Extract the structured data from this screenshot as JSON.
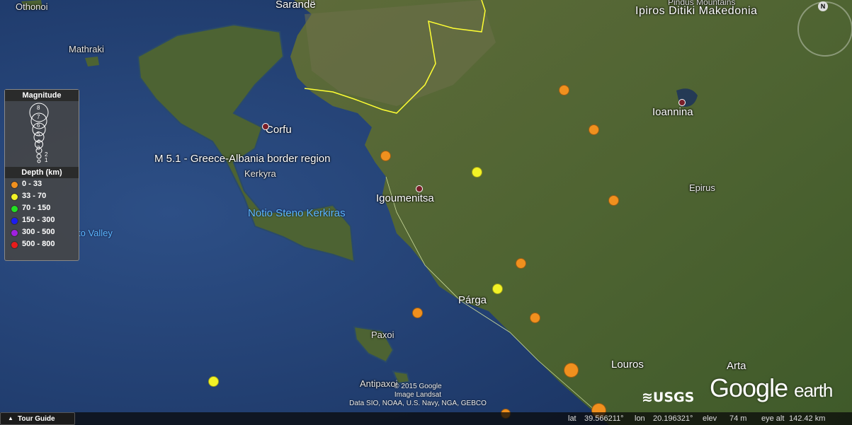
{
  "map": {
    "place_labels": {
      "othonoi": "Othonoi",
      "sarande": "Sarandë",
      "ipiros": "Ipiros Ditiki Makedonia",
      "pindus": "Pindus Mountains",
      "mathraki": "Mathraki",
      "corfu": "Corfu",
      "kerkyra": "Kerkyra",
      "ioannina": "Ioannina",
      "igoumenitsa": "Igoumenitsa",
      "epirus": "Epirus",
      "notio": "Notio Steno Kerkiras",
      "valley": "to Valley",
      "parga": "Párga",
      "paxoi": "Paxoi",
      "antipaxoi": "Antipaxoi",
      "louros": "Louros",
      "arta": "Arta"
    },
    "quake_label": "M 5.1 - Greece-Albania border region",
    "quakes": [
      {
        "depth_class": "0-33",
        "color": "#f0901e"
      },
      {
        "depth_class": "0-33",
        "color": "#f0901e"
      },
      {
        "depth_class": "0-33",
        "color": "#f0901e"
      },
      {
        "depth_class": "0-33",
        "color": "#f0901e"
      },
      {
        "depth_class": "0-33",
        "color": "#f0901e"
      },
      {
        "depth_class": "0-33",
        "color": "#f0901e"
      },
      {
        "depth_class": "0-33",
        "color": "#f0901e"
      },
      {
        "depth_class": "0-33",
        "color": "#f0901e"
      },
      {
        "depth_class": "0-33",
        "color": "#f0901e"
      },
      {
        "depth_class": "0-33",
        "color": "#f0901e"
      },
      {
        "depth_class": "33-70",
        "color": "#f2f226"
      },
      {
        "depth_class": "33-70",
        "color": "#f2f226"
      },
      {
        "depth_class": "33-70",
        "color": "#f2f226"
      }
    ]
  },
  "legend": {
    "magnitude_title": "Magnitude",
    "magnitude_values": [
      "8",
      "7",
      "6",
      "5",
      "4",
      "3",
      "2",
      "1"
    ],
    "depth_title": "Depth (km)",
    "depth_classes": [
      {
        "label": "0 - 33",
        "color": "#f0901e"
      },
      {
        "label": "33 - 70",
        "color": "#f2f226"
      },
      {
        "label": "70 - 150",
        "color": "#22e022"
      },
      {
        "label": "150 - 300",
        "color": "#1c1cf0"
      },
      {
        "label": "300 - 500",
        "color": "#a020e0"
      },
      {
        "label": "500 - 800",
        "color": "#e81c1c"
      }
    ]
  },
  "attribution": {
    "line1": "© 2015 Google",
    "line2": "Image Landsat",
    "line3": "Data SIO, NOAA, U.S. Navy, NGA, GEBCO"
  },
  "logos": {
    "usgs": "≋USGS",
    "google": "Google",
    "earth": "earth"
  },
  "status_bar": {
    "tour_guide": "Tour Guide",
    "lat_label": "lat",
    "lat_value": "39.566211°",
    "lon_label": "lon",
    "lon_value": "20.196321°",
    "elev_label": "elev",
    "elev_value": "74 m",
    "eye_label": "eye alt",
    "eye_value": "142.42 km"
  },
  "compass_north": "N"
}
